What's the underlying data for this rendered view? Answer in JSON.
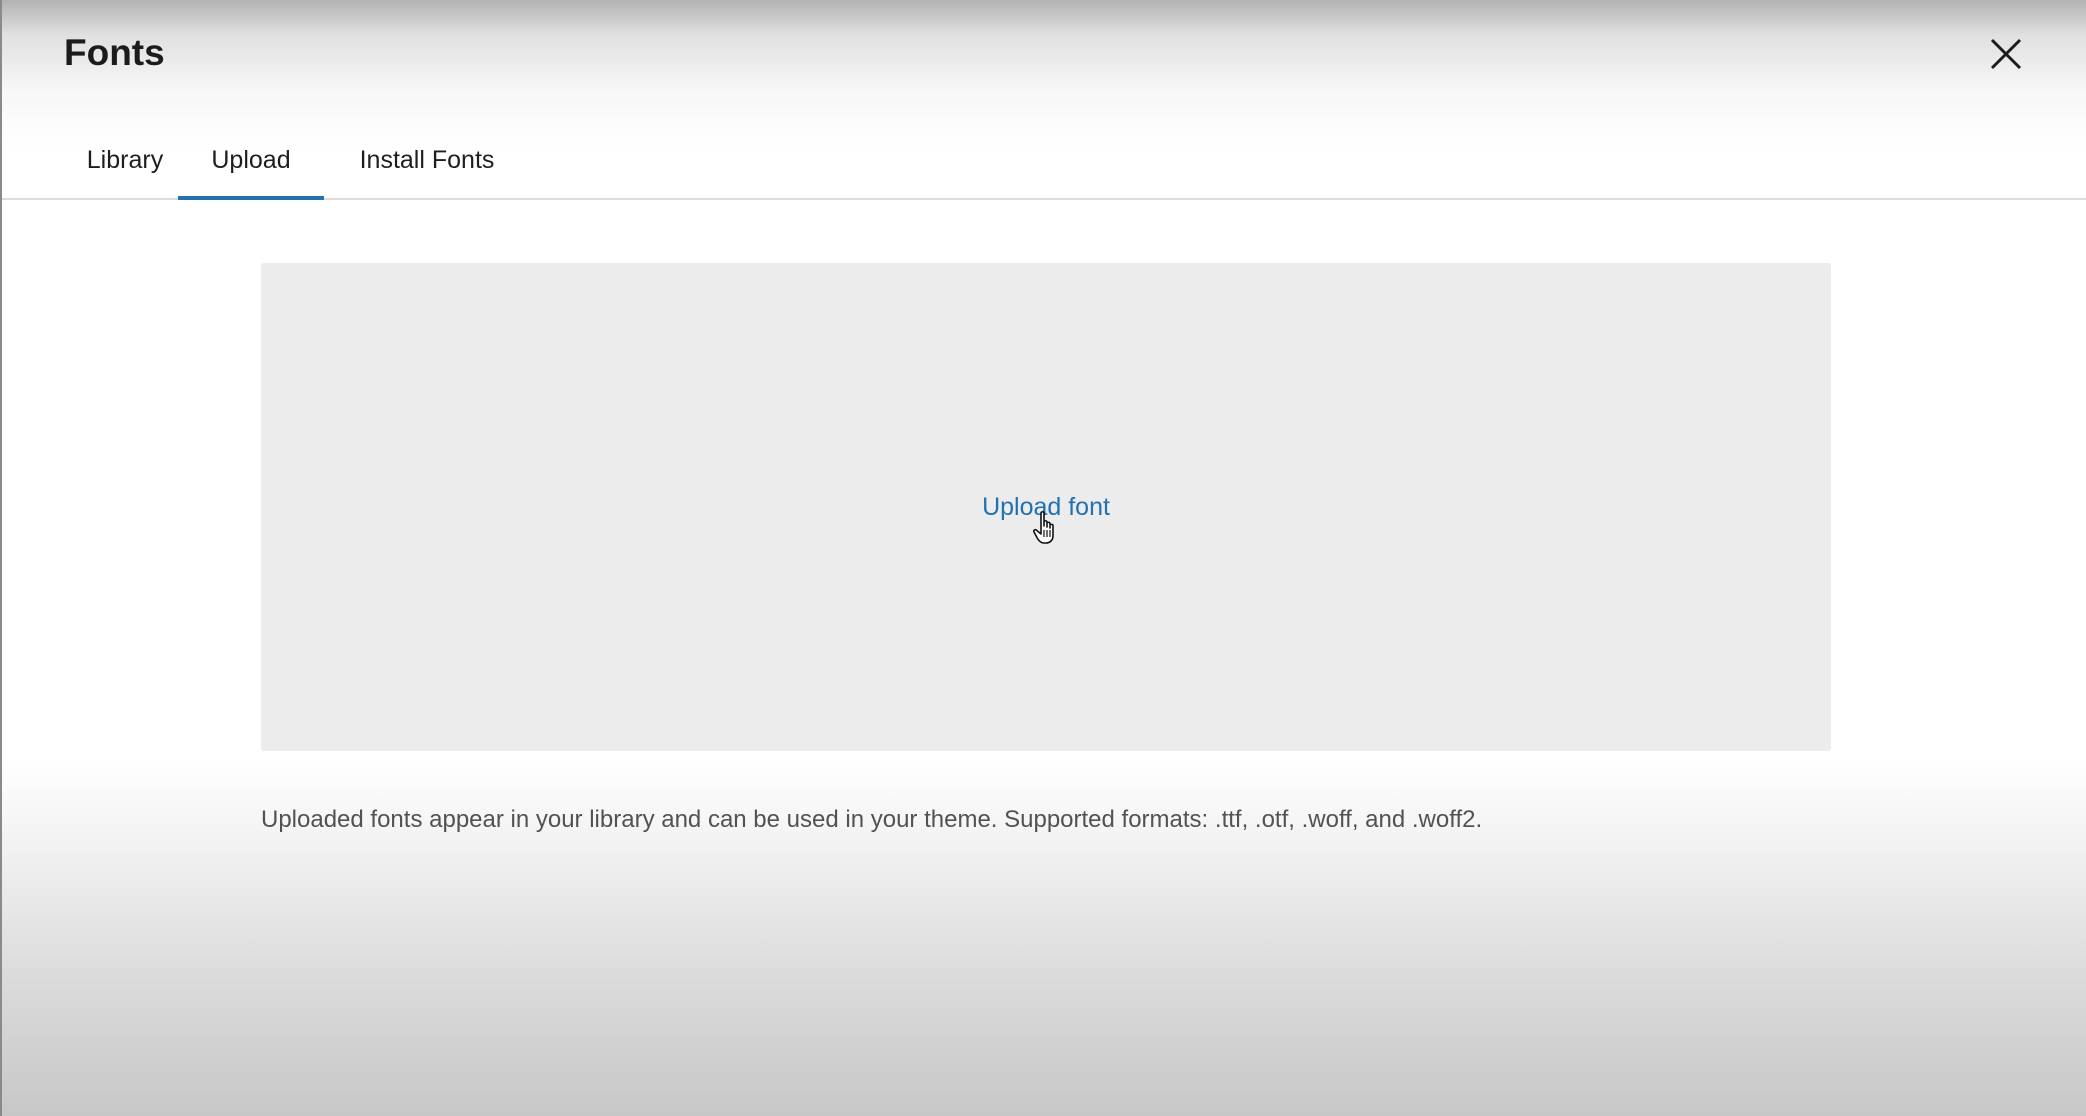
{
  "modal": {
    "title": "Fonts",
    "close_icon": "close-icon"
  },
  "tabs": [
    {
      "label": "Library",
      "active": false
    },
    {
      "label": "Upload",
      "active": true
    },
    {
      "label": "Install Fonts",
      "active": false
    }
  ],
  "upload": {
    "link_label": "Upload font",
    "help_text": "Uploaded fonts appear in your library and can be used in your theme. Supported formats: .ttf, .otf, .woff, and .woff2."
  },
  "colors": {
    "accent": "#2271b1",
    "dropzone_bg": "#ececec",
    "text": "#1e1e1e",
    "muted_text": "#555555"
  },
  "cursor": "hand-pointer-icon"
}
